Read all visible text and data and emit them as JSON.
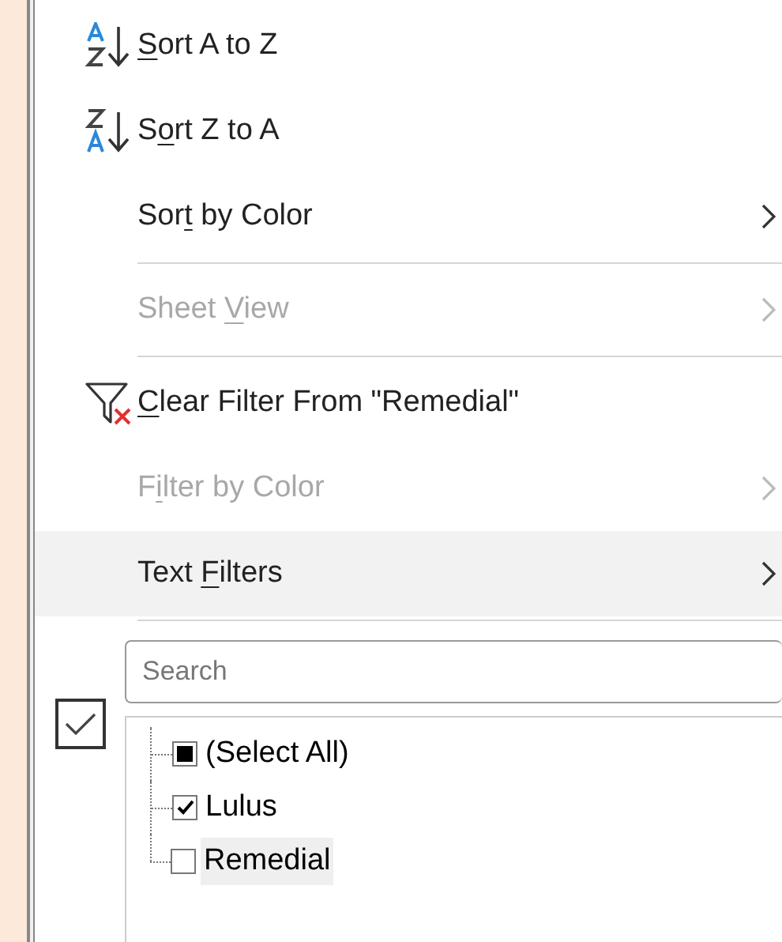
{
  "menu_items": [
    {
      "kind": "item",
      "key": "S",
      "post": "ort A to Z",
      "disabled": false,
      "submenu": false,
      "highlighted": false
    },
    {
      "kind": "item",
      "pre": "S",
      "key": "o",
      "post": "rt Z to A",
      "disabled": false,
      "submenu": false,
      "highlighted": false
    },
    {
      "kind": "item",
      "pre": "Sor",
      "key": "t",
      "post": " by Color",
      "disabled": false,
      "submenu": true,
      "highlighted": false
    },
    {
      "kind": "separator"
    },
    {
      "kind": "item",
      "pre": "Sheet ",
      "key": "V",
      "post": "iew",
      "disabled": true,
      "submenu": true,
      "highlighted": false
    },
    {
      "kind": "separator"
    },
    {
      "kind": "item",
      "key": "C",
      "post": "lear Filter From \"Remedial\"",
      "disabled": false,
      "submenu": false,
      "highlighted": false
    },
    {
      "kind": "item",
      "pre": "F",
      "key": "i",
      "post": "lter by Color",
      "disabled": true,
      "submenu": true,
      "highlighted": false
    },
    {
      "kind": "item",
      "pre": "Text ",
      "key": "F",
      "post": "ilters",
      "disabled": false,
      "submenu": true,
      "highlighted": true
    },
    {
      "kind": "separator"
    }
  ],
  "side_checkbox": {
    "checked": true
  },
  "search": {
    "placeholder": "Search"
  },
  "values": [
    {
      "label": "(Select All)",
      "checked": false,
      "partial": true,
      "highlighted": false
    },
    {
      "label": "Lulus",
      "checked": true,
      "partial": false,
      "highlighted": false
    },
    {
      "label": "Remedial",
      "checked": false,
      "partial": false,
      "highlighted": true
    }
  ]
}
